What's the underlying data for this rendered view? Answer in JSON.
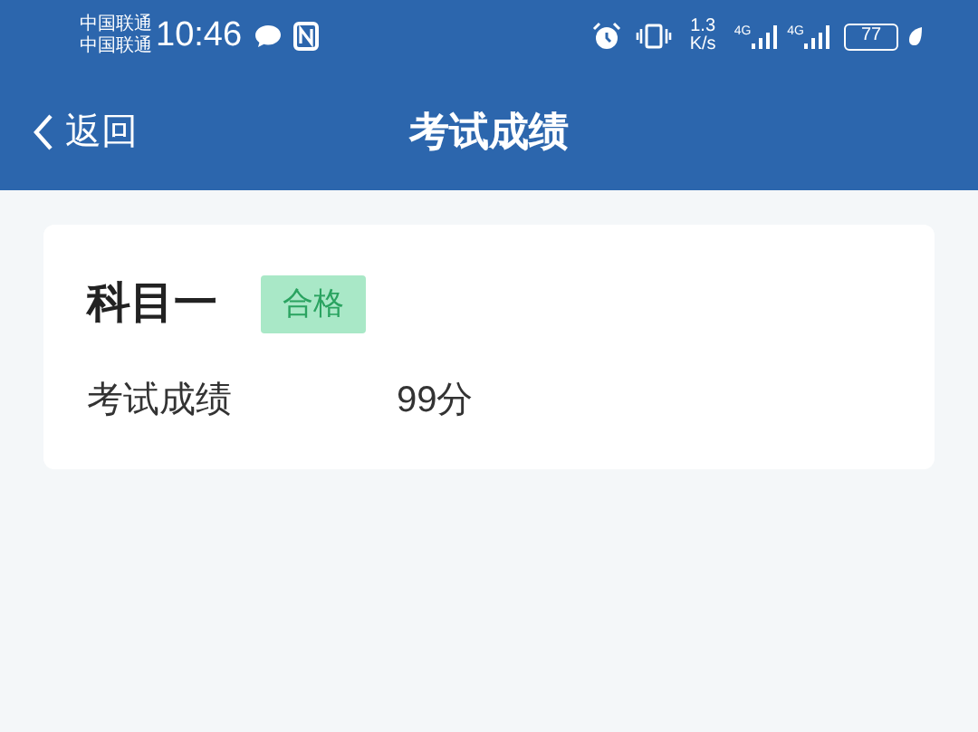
{
  "status_bar": {
    "carriers": [
      "中国联通",
      "中国联通"
    ],
    "time": "10:46",
    "speed_value": "1.3",
    "speed_unit": "K/s",
    "networks": [
      "4G",
      "4G"
    ],
    "battery": "77"
  },
  "nav": {
    "back": "返回",
    "title": "考试成绩"
  },
  "results": [
    {
      "subject": "科目一",
      "badge": "合格",
      "passed": true,
      "label": "考试成绩",
      "score": "99分"
    }
  ]
}
